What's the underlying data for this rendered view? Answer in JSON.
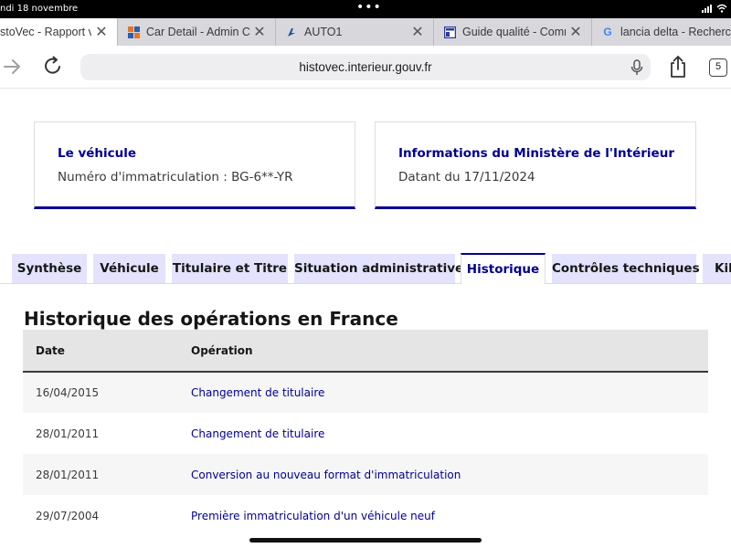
{
  "status_bar": {
    "time": "ndi 18 novembre",
    "dots": "•••"
  },
  "browser": {
    "tabs": [
      {
        "title": "stoVec - Rapport ve",
        "icon": "histovec-icon",
        "active": true
      },
      {
        "title": "Car Detail - Admin Ce",
        "icon": "admin-grid-icon",
        "active": false
      },
      {
        "title": "AUTO1",
        "icon": "auto1-icon",
        "active": false
      },
      {
        "title": "Guide qualité - Comm",
        "icon": "document-icon",
        "active": false
      },
      {
        "title": "lancia delta - Recherc",
        "icon": "google-icon",
        "active": false
      }
    ],
    "url": "histovec.interieur.gouv.fr",
    "tab_count": "5"
  },
  "cards": [
    {
      "title": "Le véhicule",
      "text": "Numéro d'immatriculation : BG-6**-YR"
    },
    {
      "title": "Informations du Ministère de l'Intérieur",
      "text": "Datant du 17/11/2024"
    }
  ],
  "page_tabs": [
    {
      "label": "Synthèse",
      "active": false
    },
    {
      "label": "Véhicule",
      "active": false
    },
    {
      "label": "Titulaire et Titre",
      "active": false
    },
    {
      "label": "Situation administrative",
      "active": false
    },
    {
      "label": "Historique",
      "active": true
    },
    {
      "label": "Contrôles techniques",
      "active": false
    },
    {
      "label": "Kil",
      "active": false
    }
  ],
  "history": {
    "title": "Historique des opérations en France",
    "columns": [
      "Date",
      "Opération"
    ],
    "rows": [
      {
        "date": "16/04/2015",
        "operation": "Changement de titulaire"
      },
      {
        "date": "28/01/2011",
        "operation": "Changement de titulaire"
      },
      {
        "date": "28/01/2011",
        "operation": "Conversion au nouveau format d'immatriculation"
      },
      {
        "date": "29/07/2004",
        "operation": "Première immatriculation d'un véhicule neuf"
      }
    ]
  },
  "colors": {
    "accent": "#000091",
    "tab_bg": "#e3e3fd",
    "header_bg": "#e5e5e5"
  }
}
